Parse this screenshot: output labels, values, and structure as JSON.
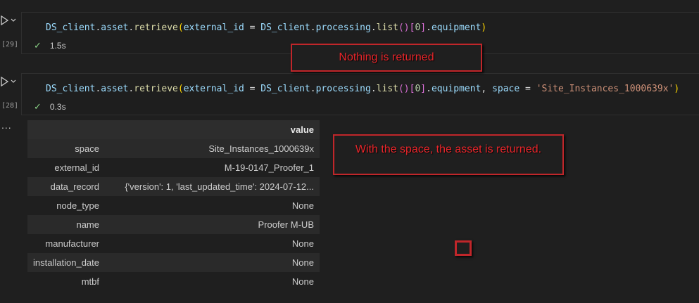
{
  "cells": [
    {
      "exec_count": "[29]",
      "code_tokens": [
        {
          "t": "DS_client",
          "c": "c-var"
        },
        {
          "t": ".",
          "c": "c-pun"
        },
        {
          "t": "asset",
          "c": "c-var"
        },
        {
          "t": ".",
          "c": "c-pun"
        },
        {
          "t": "retrieve",
          "c": "c-fn"
        },
        {
          "t": "(",
          "c": "c-br1"
        },
        {
          "t": "external_id",
          "c": "c-var"
        },
        {
          "t": " = ",
          "c": "c-op"
        },
        {
          "t": "DS_client",
          "c": "c-var"
        },
        {
          "t": ".",
          "c": "c-pun"
        },
        {
          "t": "processing",
          "c": "c-var"
        },
        {
          "t": ".",
          "c": "c-pun"
        },
        {
          "t": "list",
          "c": "c-fn"
        },
        {
          "t": "()",
          "c": "c-br2"
        },
        {
          "t": "[",
          "c": "c-br2"
        },
        {
          "t": "0",
          "c": "c-num"
        },
        {
          "t": "]",
          "c": "c-br2"
        },
        {
          "t": ".",
          "c": "c-pun"
        },
        {
          "t": "equipment",
          "c": "c-var"
        },
        {
          "t": ")",
          "c": "c-br1"
        }
      ],
      "duration": "1.5s"
    },
    {
      "exec_count": "[28]",
      "code_tokens": [
        {
          "t": "DS_client",
          "c": "c-var"
        },
        {
          "t": ".",
          "c": "c-pun"
        },
        {
          "t": "asset",
          "c": "c-var"
        },
        {
          "t": ".",
          "c": "c-pun"
        },
        {
          "t": "retrieve",
          "c": "c-fn"
        },
        {
          "t": "(",
          "c": "c-br1"
        },
        {
          "t": "external_id",
          "c": "c-var"
        },
        {
          "t": " = ",
          "c": "c-op"
        },
        {
          "t": "DS_client",
          "c": "c-var"
        },
        {
          "t": ".",
          "c": "c-pun"
        },
        {
          "t": "processing",
          "c": "c-var"
        },
        {
          "t": ".",
          "c": "c-pun"
        },
        {
          "t": "list",
          "c": "c-fn"
        },
        {
          "t": "()",
          "c": "c-br2"
        },
        {
          "t": "[",
          "c": "c-br2"
        },
        {
          "t": "0",
          "c": "c-num"
        },
        {
          "t": "]",
          "c": "c-br2"
        },
        {
          "t": ".",
          "c": "c-pun"
        },
        {
          "t": "equipment",
          "c": "c-var"
        },
        {
          "t": ", ",
          "c": "c-pun"
        },
        {
          "t": "space",
          "c": "c-var"
        },
        {
          "t": " = ",
          "c": "c-op"
        },
        {
          "t": "'Site_Instances_1000639x'",
          "c": "c-str"
        },
        {
          "t": ")",
          "c": "c-br1"
        }
      ],
      "duration": "0.3s"
    }
  ],
  "output": {
    "more_label": "...",
    "header_value": "value",
    "rows": [
      {
        "key": "space",
        "value": "Site_Instances_1000639x"
      },
      {
        "key": "external_id",
        "value": "M-19-0147_Proofer_1"
      },
      {
        "key": "data_record",
        "value": "{'version': 1, 'last_updated_time': 2024-07-12..."
      },
      {
        "key": "node_type",
        "value": "None"
      },
      {
        "key": "name",
        "value": "Proofer M-UB"
      },
      {
        "key": "manufacturer",
        "value": "None"
      },
      {
        "key": "installation_date",
        "value": "None"
      },
      {
        "key": "mtbf",
        "value": "None"
      }
    ]
  },
  "annotations": {
    "nothing_returned": "Nothing is returned",
    "with_space": "With the space, the asset is returned."
  },
  "colors": {
    "annotation_border": "#c0262a",
    "annotation_text": "#e8262b",
    "success_check": "#89d185"
  }
}
